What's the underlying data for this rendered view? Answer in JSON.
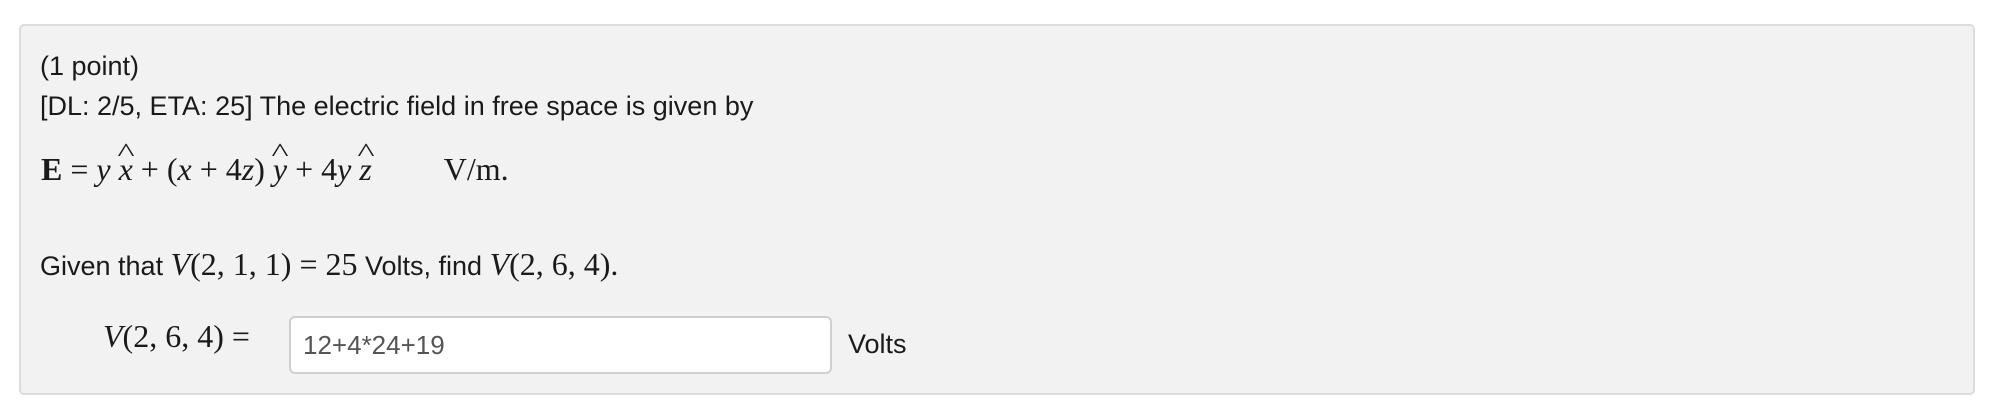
{
  "problem": {
    "points": "(1 point)",
    "intro": "[DL: 2/5, ETA: 25] The electric field in free space is given by",
    "equation": {
      "lhs": "E",
      "eq": " = ",
      "t1": "y",
      "x_hat": "x",
      "plus1": " + (",
      "t2": "x",
      "plus2": " + 4",
      "t3": "z",
      "close": ") ",
      "y_hat": "y",
      "plus3": " + 4",
      "t4": "y",
      "z_hat": "z",
      "unit": "V/m."
    },
    "given": {
      "prefix": "Given that ",
      "fn1": "V",
      "args1": "(2, 1, 1) = 25",
      "mid": " Volts, find ",
      "fn2": "V",
      "args2": "(2, 6, 4).",
      "suffix": ""
    },
    "answer": {
      "label_fn": "V",
      "label_args": "(2, 6, 4) =",
      "value": "12+4*24+19",
      "units": "Volts"
    }
  }
}
